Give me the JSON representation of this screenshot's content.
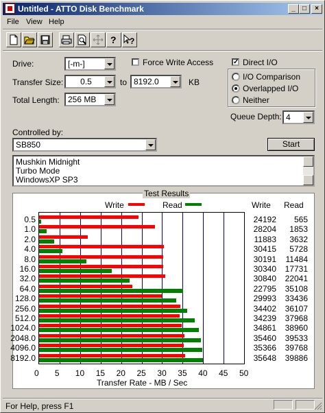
{
  "window": {
    "title": "Untitled - ATTO Disk Benchmark"
  },
  "title_buttons": {
    "minimize": "_",
    "maximize": "□",
    "close": "×"
  },
  "menu": [
    "File",
    "View",
    "Help"
  ],
  "toolbar": {
    "icons": [
      "new-file-icon",
      "open-folder-icon",
      "save-disk-icon",
      "print-icon",
      "print-preview-icon",
      "move-icon",
      "help-icon",
      "context-help-icon"
    ]
  },
  "form": {
    "drive_label": "Drive:",
    "drive_value": "[-m-]",
    "force_write_label": "Force Write Access",
    "force_write_checked": false,
    "direct_io_label": "Direct I/O",
    "direct_io_checked": true,
    "transfer_size_label": "Transfer Size:",
    "transfer_from": "0.5",
    "to_label": "to",
    "transfer_to": "8192.0",
    "kb_label": "KB",
    "total_length_label": "Total Length:",
    "total_length_value": "256 MB",
    "io_modes": [
      {
        "label": "I/O Comparison",
        "selected": false
      },
      {
        "label": "Overlapped I/O",
        "selected": true
      },
      {
        "label": "Neither",
        "selected": false
      }
    ],
    "queue_depth_label": "Queue Depth:",
    "queue_depth_value": "4",
    "controlled_by_label": "Controlled by:",
    "controlled_by_value": "SB850",
    "start_button": "Start",
    "description_lines": [
      "Mushkin Midnight",
      "Turbo Mode",
      "WindowsXP SP3"
    ]
  },
  "chart_data": {
    "type": "bar",
    "title": "Test Results",
    "legend": [
      {
        "name": "Write",
        "color": "#ff0000"
      },
      {
        "name": "Read",
        "color": "#008000"
      }
    ],
    "xlabel": "Transfer Rate - MB / Sec",
    "xlim": [
      0,
      50
    ],
    "xticks": [
      "0",
      "5",
      "10",
      "15",
      "20",
      "25",
      "30",
      "35",
      "40",
      "45",
      "50"
    ],
    "categories": [
      "0.5",
      "1.0",
      "2.0",
      "4.0",
      "8.0",
      "16.0",
      "32.0",
      "64.0",
      "128.0",
      "256.0",
      "512.0",
      "1024.0",
      "2048.0",
      "4096.0",
      "8192.0"
    ],
    "series": [
      {
        "name": "Write",
        "color": "#ff0000",
        "values": [
          24192,
          28204,
          11883,
          30415,
          30191,
          30340,
          30840,
          22795,
          29993,
          34402,
          34239,
          34861,
          35460,
          35366,
          35648
        ]
      },
      {
        "name": "Read",
        "color": "#008000",
        "values": [
          565,
          1853,
          3632,
          5728,
          11484,
          17731,
          22041,
          35108,
          33436,
          36107,
          37968,
          38960,
          39533,
          39768,
          39886
        ]
      }
    ],
    "col_headers": {
      "write": "Write",
      "read": "Read"
    }
  },
  "status": {
    "text": "For Help, press F1"
  }
}
